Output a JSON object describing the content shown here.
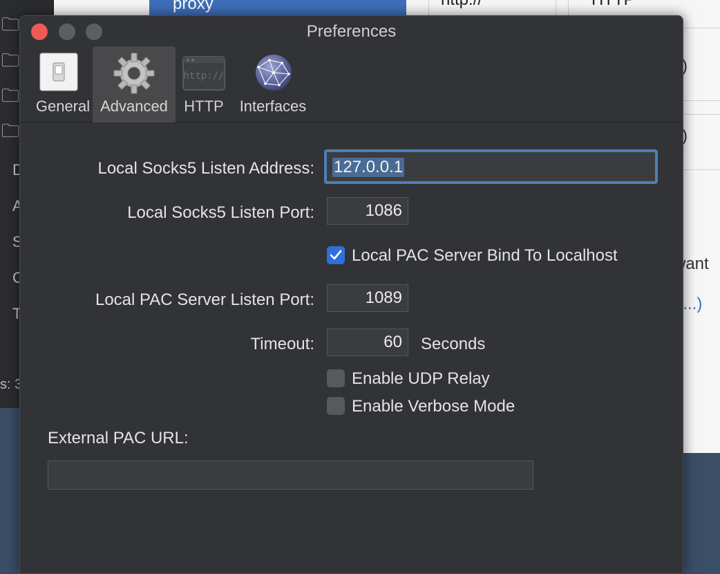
{
  "background": {
    "selected_row_text": "proxy",
    "header_fragment_1": "http://",
    "header_fragment_2": "HTTP",
    "right_text_1": "lt)",
    "right_text_2": "lt)",
    "right_text_3": "want",
    "right_text_4": "e...)",
    "sidebar_letters": [
      "D",
      "A",
      "S",
      "C",
      "T"
    ],
    "status_text": "s: 3"
  },
  "window": {
    "title": "Preferences"
  },
  "toolbar": {
    "tabs": [
      {
        "label": "General",
        "icon": "switch-icon",
        "selected": false
      },
      {
        "label": "Advanced",
        "icon": "gear-icon",
        "selected": true
      },
      {
        "label": "HTTP",
        "icon": "http-icon",
        "selected": false
      },
      {
        "label": "Interfaces",
        "icon": "globe-icon",
        "selected": false
      }
    ]
  },
  "form": {
    "socks_address_label": "Local Socks5 Listen Address:",
    "socks_address_value": "127.0.0.1",
    "socks_port_label": "Local Socks5 Listen Port:",
    "socks_port_value": "1086",
    "pac_bind_label": "Local PAC Server Bind To Localhost",
    "pac_bind_checked": true,
    "pac_port_label": "Local PAC Server Listen Port:",
    "pac_port_value": "1089",
    "timeout_label": "Timeout:",
    "timeout_value": "60",
    "timeout_unit": "Seconds",
    "udp_relay_label": "Enable UDP Relay",
    "udp_relay_checked": false,
    "verbose_label": "Enable Verbose Mode",
    "verbose_checked": false,
    "external_pac_label": "External PAC URL:",
    "external_pac_value": ""
  },
  "colors": {
    "accent": "#2f6fdb",
    "focus_ring": "#4d7fb4",
    "close_button": "#ee5b55"
  }
}
